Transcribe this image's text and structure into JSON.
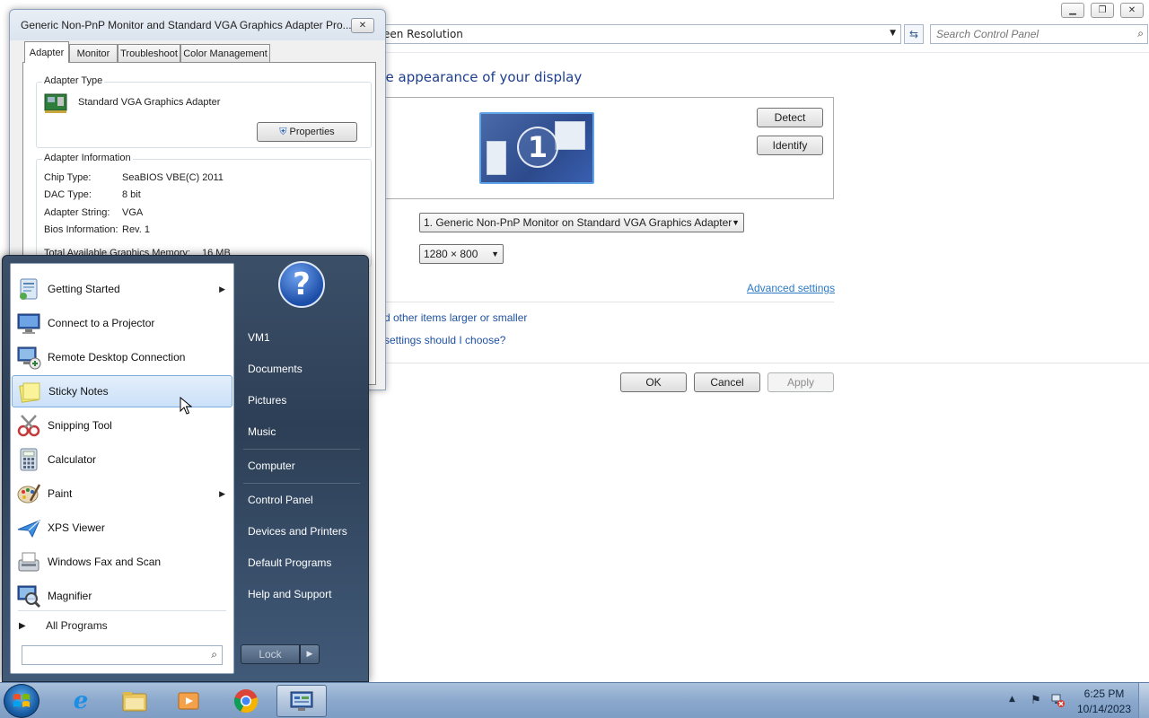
{
  "control_panel": {
    "address_text": "een Resolution",
    "search_placeholder": "Search Control Panel",
    "heading": "he appearance of your display",
    "detect_label": "Detect",
    "identify_label": "Identify",
    "monitor_number": "1",
    "display_select": "1. Generic Non-PnP Monitor on Standard VGA Graphics Adapter",
    "resolution_select": "1280 × 800",
    "advanced_link": "Advanced settings",
    "link_larger": "d other items larger or smaller",
    "link_choose": "settings should I choose?",
    "ok_label": "OK",
    "cancel_label": "Cancel",
    "apply_label": "Apply"
  },
  "dialog": {
    "title": "Generic Non-PnP Monitor and Standard VGA Graphics Adapter Pro...",
    "tabs": [
      "Adapter",
      "Monitor",
      "Troubleshoot",
      "Color Management"
    ],
    "adapter_type_group": "Adapter Type",
    "adapter_name": "Standard VGA Graphics Adapter",
    "properties_label": "Properties",
    "adapter_info_group": "Adapter Information",
    "chip_type_label": "Chip Type:",
    "chip_type_value": "SeaBIOS VBE(C) 2011",
    "dac_type_label": "DAC Type:",
    "dac_type_value": "8 bit",
    "adapter_string_label": "Adapter String:",
    "adapter_string_value": "VGA",
    "bios_info_label": "Bios Information:",
    "bios_info_value": "Rev. 1",
    "total_memory_label": "Total Available Graphics Memory:",
    "total_memory_value": "16 MB"
  },
  "start_menu": {
    "programs": [
      {
        "label": "Getting Started",
        "icon": "getting-started-icon",
        "submenu": true
      },
      {
        "label": "Connect to a Projector",
        "icon": "projector-icon",
        "submenu": false
      },
      {
        "label": "Remote Desktop Connection",
        "icon": "remote-desktop-icon",
        "submenu": false
      },
      {
        "label": "Sticky Notes",
        "icon": "sticky-notes-icon",
        "submenu": false
      },
      {
        "label": "Snipping Tool",
        "icon": "snipping-tool-icon",
        "submenu": false
      },
      {
        "label": "Calculator",
        "icon": "calculator-icon",
        "submenu": false
      },
      {
        "label": "Paint",
        "icon": "paint-icon",
        "submenu": true
      },
      {
        "label": "XPS Viewer",
        "icon": "xps-viewer-icon",
        "submenu": false
      },
      {
        "label": "Windows Fax and Scan",
        "icon": "fax-scan-icon",
        "submenu": false
      },
      {
        "label": "Magnifier",
        "icon": "magnifier-icon",
        "submenu": false
      }
    ],
    "hovered_item": "Sticky Notes",
    "all_programs": "All Programs",
    "search_placeholder": "",
    "right_items": [
      "VM1",
      "Documents",
      "Pictures",
      "Music",
      "Computer",
      "Control Panel",
      "Devices and Printers",
      "Default Programs",
      "Help and Support"
    ],
    "lock_label": "Lock"
  },
  "taskbar": {
    "pinned": [
      "internet-explorer-icon",
      "file-explorer-icon",
      "media-player-icon",
      "chrome-icon",
      "control-panel-icon"
    ],
    "active_app": "control-panel-icon",
    "time": "6:25 PM",
    "date": "10/14/2023"
  },
  "colors": {
    "heading_blue": "#1e3f8e",
    "link_blue": "#2b7ac4",
    "taskbar": "#8ba8cc",
    "start_menu_right": "#2d3f56"
  }
}
